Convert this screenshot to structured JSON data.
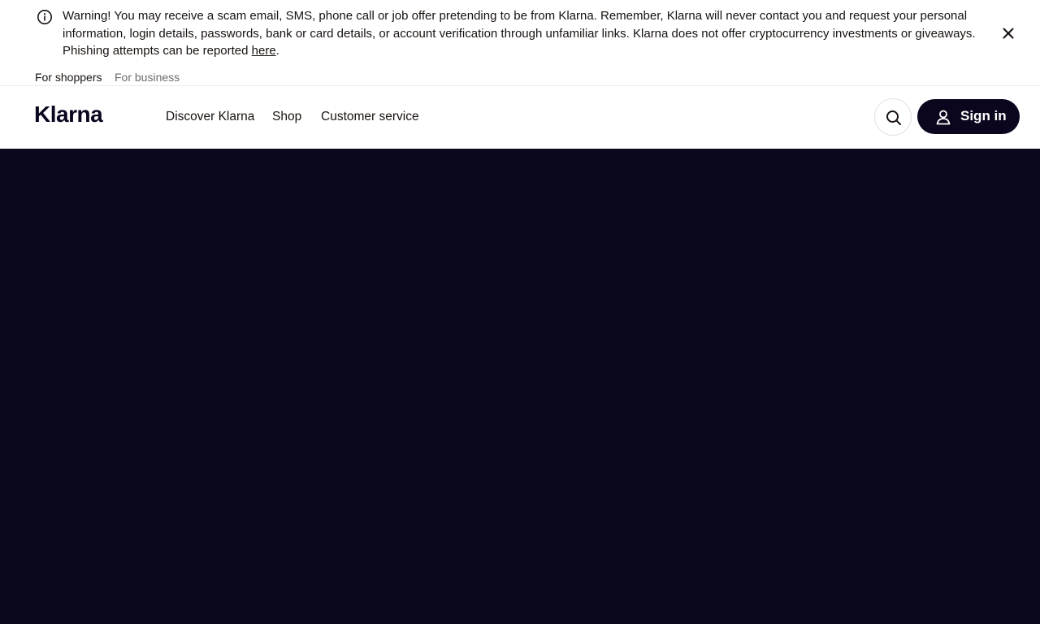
{
  "warning": {
    "text": "Warning! You may receive a scam email, SMS, phone call or job offer pretending to be from Klarna. Remember, Klarna will never contact you and request your personal information, login details, passwords, bank or card details, or account verification through unfamiliar links. Klarna does not offer cryptocurrency investments or giveaways. Phishing attempts can be reported ",
    "link_label": "here",
    "suffix": ".",
    "icon": "info-icon",
    "close_icon": "close-icon"
  },
  "audience_tabs": [
    {
      "label": "For shoppers",
      "active": true
    },
    {
      "label": "For business",
      "active": false
    }
  ],
  "header": {
    "logo": "Klarna",
    "nav": [
      "Discover Klarna",
      "Shop",
      "Customer service"
    ],
    "search_icon": "search-icon",
    "signin_label": "Sign in",
    "signin_icon": "user-icon"
  },
  "colors": {
    "brand_dark": "#0b051d",
    "hero_bg": "#0b071c",
    "muted_text": "#6d6b6a"
  }
}
